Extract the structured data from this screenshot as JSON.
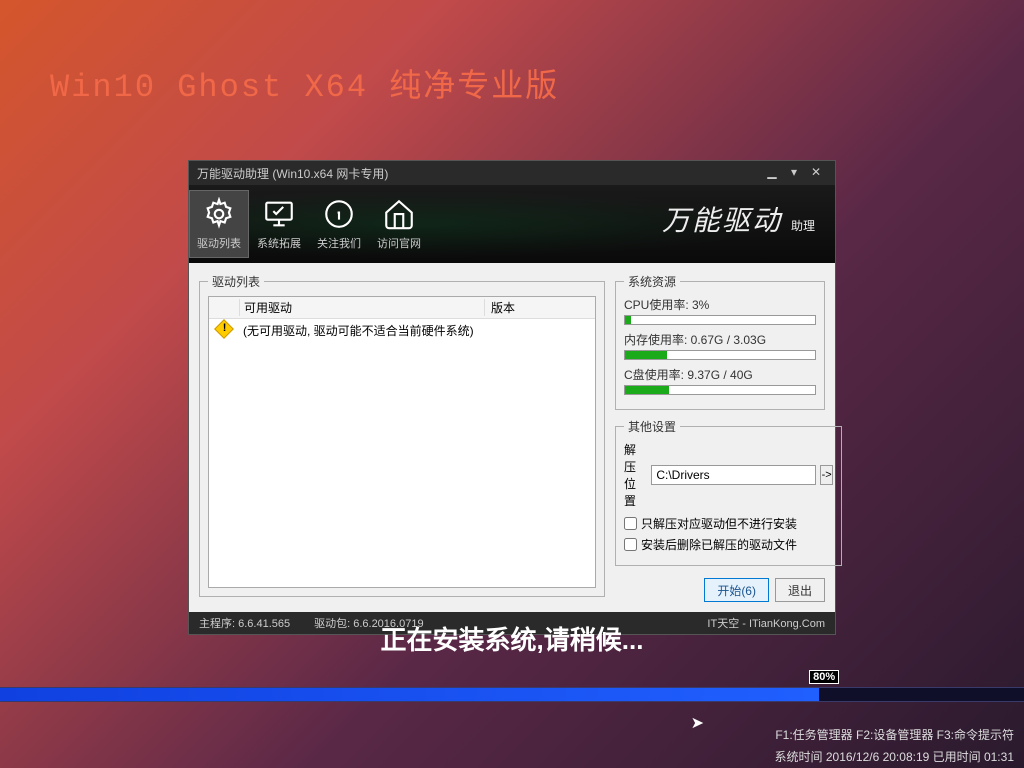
{
  "page": {
    "title": "Win10 Ghost X64 纯净专业版"
  },
  "window": {
    "title": "万能驱动助理 (Win10.x64 网卡专用)",
    "brand_main": "万能驱动",
    "brand_sub": "助理",
    "tabs": [
      {
        "label": "驱动列表"
      },
      {
        "label": "系统拓展"
      },
      {
        "label": "关注我们"
      },
      {
        "label": "访问官网"
      }
    ]
  },
  "driver_panel": {
    "legend": "驱动列表",
    "col_available": "可用驱动",
    "col_version": "版本",
    "empty_msg": "(无可用驱动, 驱动可能不适合当前硬件系统)"
  },
  "resources": {
    "legend": "系统资源",
    "cpu": {
      "label": "CPU使用率:  3%",
      "pct": 3
    },
    "mem": {
      "label": "内存使用率:  0.67G / 3.03G",
      "pct": 22
    },
    "disk": {
      "label": "C盘使用率:  9.37G / 40G",
      "pct": 23
    }
  },
  "settings": {
    "legend": "其他设置",
    "extract_label": "解压位置",
    "extract_path": "C:\\Drivers",
    "browse": "->",
    "chk_extract_only": "只解压对应驱动但不进行安装",
    "chk_delete_after": "安装后删除已解压的驱动文件"
  },
  "actions": {
    "start": "开始(6)",
    "exit": "退出"
  },
  "statusbar": {
    "main": "主程序: 6.6.41.565",
    "pack": "驱动包: 6.6.2016.0719",
    "credit": "IT天空 - ITianKong.Com"
  },
  "install": {
    "message": "正在安装系统,请稍候...",
    "progress_pct": 80,
    "progress_label": "80%"
  },
  "bottom": {
    "line1": "F1:任务管理器  F2:设备管理器  F3:命令提示符",
    "line2": "系统时间 2016/12/6 20:08:19   已用时间 01:31"
  }
}
